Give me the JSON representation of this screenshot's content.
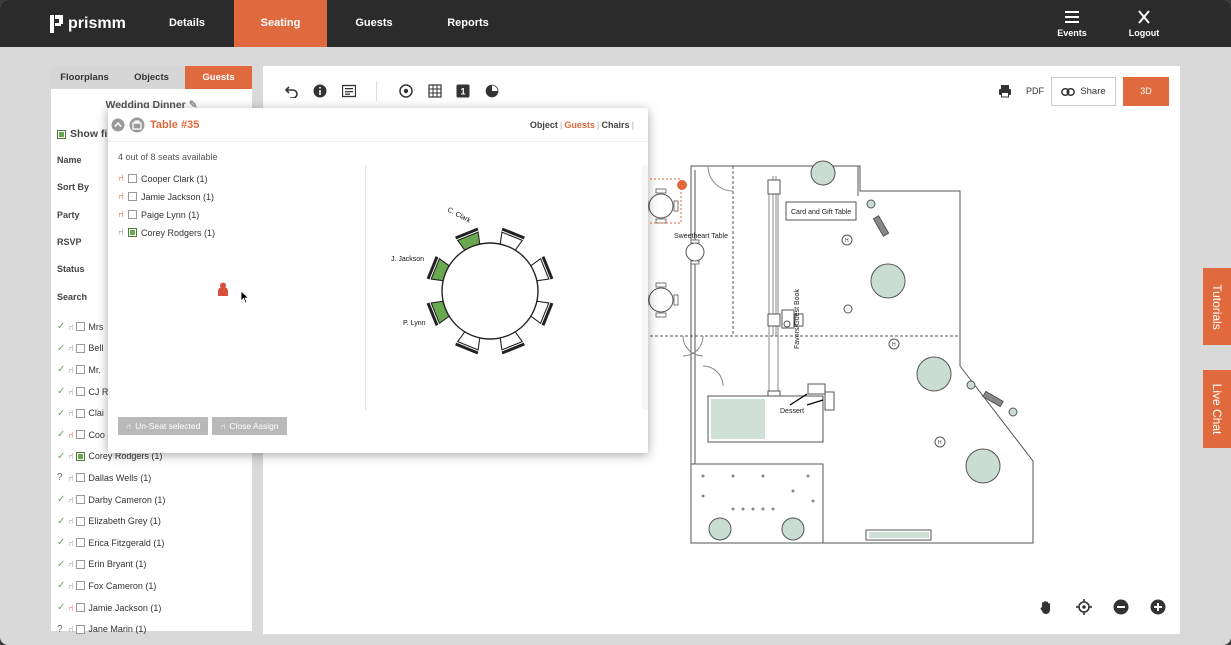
{
  "nav": {
    "logo": "prismm",
    "items": [
      "Details",
      "Seating",
      "Guests",
      "Reports"
    ],
    "events": "Events",
    "logout": "Logout"
  },
  "left_panel": {
    "tabs": [
      "Floorplans",
      "Objects",
      "Guests"
    ],
    "title": "Wedding Dinner",
    "show_label": "Show fi",
    "filters": [
      "Name",
      "Sort By",
      "Party",
      "RSVP",
      "Status",
      "Search"
    ],
    "guests": [
      {
        "name": "Mrs",
        "rsvp": "tick",
        "seated": false
      },
      {
        "name": "Bell",
        "rsvp": "tick",
        "seated": false
      },
      {
        "name": "Mr.",
        "rsvp": "tick",
        "seated": false
      },
      {
        "name": "CJ R",
        "rsvp": "tick",
        "seated": false
      },
      {
        "name": "Clai",
        "rsvp": "tick",
        "seated": false
      },
      {
        "name": "Coo",
        "rsvp": "tick",
        "seated": true
      },
      {
        "name": "Corey Rodgers (1)",
        "rsvp": "tick",
        "seated": false
      },
      {
        "name": "Dallas Wells (1)",
        "rsvp": "question",
        "seated": false
      },
      {
        "name": "Darby Cameron (1)",
        "rsvp": "tick",
        "seated": false
      },
      {
        "name": "Elizabeth Grey (1)",
        "rsvp": "tick",
        "seated": false
      },
      {
        "name": "Erica Fitzgerald (1)",
        "rsvp": "tick",
        "seated": false
      },
      {
        "name": "Erin Bryant (1)",
        "rsvp": "tick",
        "seated": false
      },
      {
        "name": "Fox Cameron (1)",
        "rsvp": "tick",
        "seated": false
      },
      {
        "name": "Jamie Jackson (1)",
        "rsvp": "tick",
        "seated": true
      },
      {
        "name": "Jane Marin (1)",
        "rsvp": "question",
        "seated": false
      }
    ]
  },
  "toolbar": {
    "pdf": "PDF",
    "share": "Share",
    "three_d": "3D"
  },
  "popup": {
    "title": "Table #35",
    "tabs": [
      "Object",
      "Guests",
      "Chairs"
    ],
    "seats_available": "4 out of 8 seats available",
    "seated_guests": [
      {
        "name": "Cooper Clark (1)",
        "checked": false
      },
      {
        "name": "Jamie Jackson (1)",
        "checked": false
      },
      {
        "name": "Paige Lynn (1)",
        "checked": false
      },
      {
        "name": "Corey Rodgers (1)",
        "checked": true
      }
    ],
    "chair_labels": {
      "c_clark": "C. Clark",
      "j_jackson": "J. Jackson",
      "p_lynn": "P. Lynn"
    },
    "btn_unseat": "Un-Seat selected",
    "btn_close": "Close Assign"
  },
  "floorplan": {
    "labels": {
      "sweetheart": "Sweetheart Table",
      "card_gift": "Card and Gift Table",
      "favors": "Favors/Guest Book",
      "dessert": "Dessert"
    }
  },
  "side_tabs": {
    "tutorials": "Tutorials",
    "live_chat": "Live Chat"
  },
  "colors": {
    "accent": "#e06a3e",
    "nav_bg": "#2b2b2b",
    "seat_green": "#6aa84f"
  }
}
